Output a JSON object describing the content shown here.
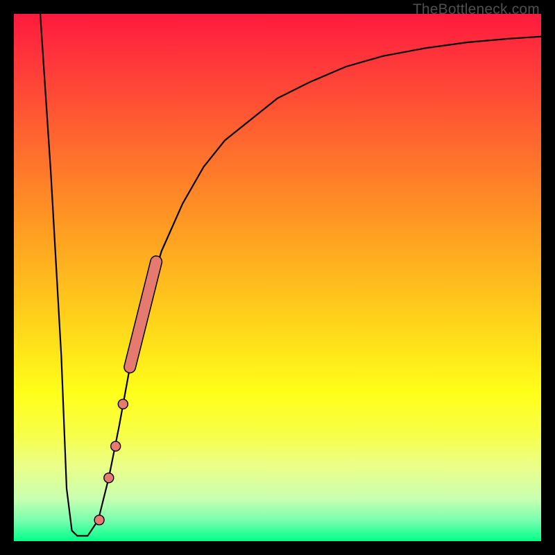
{
  "watermark": "TheBottleneck.com",
  "chart_data": {
    "type": "line",
    "title": "",
    "xlabel": "",
    "ylabel": "",
    "xlim": [
      0,
      100
    ],
    "ylim": [
      0,
      100
    ],
    "grid": false,
    "series": [
      {
        "name": "bottleneck-curve",
        "x": [
          5,
          7,
          9,
          10,
          11,
          12,
          14,
          16,
          18,
          20,
          22,
          25,
          28,
          32,
          36,
          40,
          45,
          50,
          56,
          63,
          70,
          78,
          86,
          94,
          100
        ],
        "y": [
          100,
          70,
          35,
          10,
          2,
          1,
          1,
          4,
          12,
          22,
          33,
          45,
          55,
          64,
          71,
          76,
          80,
          84,
          87,
          90,
          92,
          93.5,
          94.6,
          95.3,
          95.7
        ]
      }
    ],
    "markers": {
      "name": "highlight-segment",
      "band_start": {
        "x": 22.0,
        "y": 33
      },
      "band_end": {
        "x": 27.0,
        "y": 53
      },
      "points": [
        {
          "x": 18.0,
          "y": 12
        },
        {
          "x": 19.3,
          "y": 18
        },
        {
          "x": 20.7,
          "y": 26
        },
        {
          "x": 16.2,
          "y": 4
        }
      ]
    },
    "colors": {
      "curve": "#000000",
      "marker_fill": "#e57b6f",
      "gradient_top": "#ff1a3e",
      "gradient_bottom": "#00ff88"
    }
  }
}
